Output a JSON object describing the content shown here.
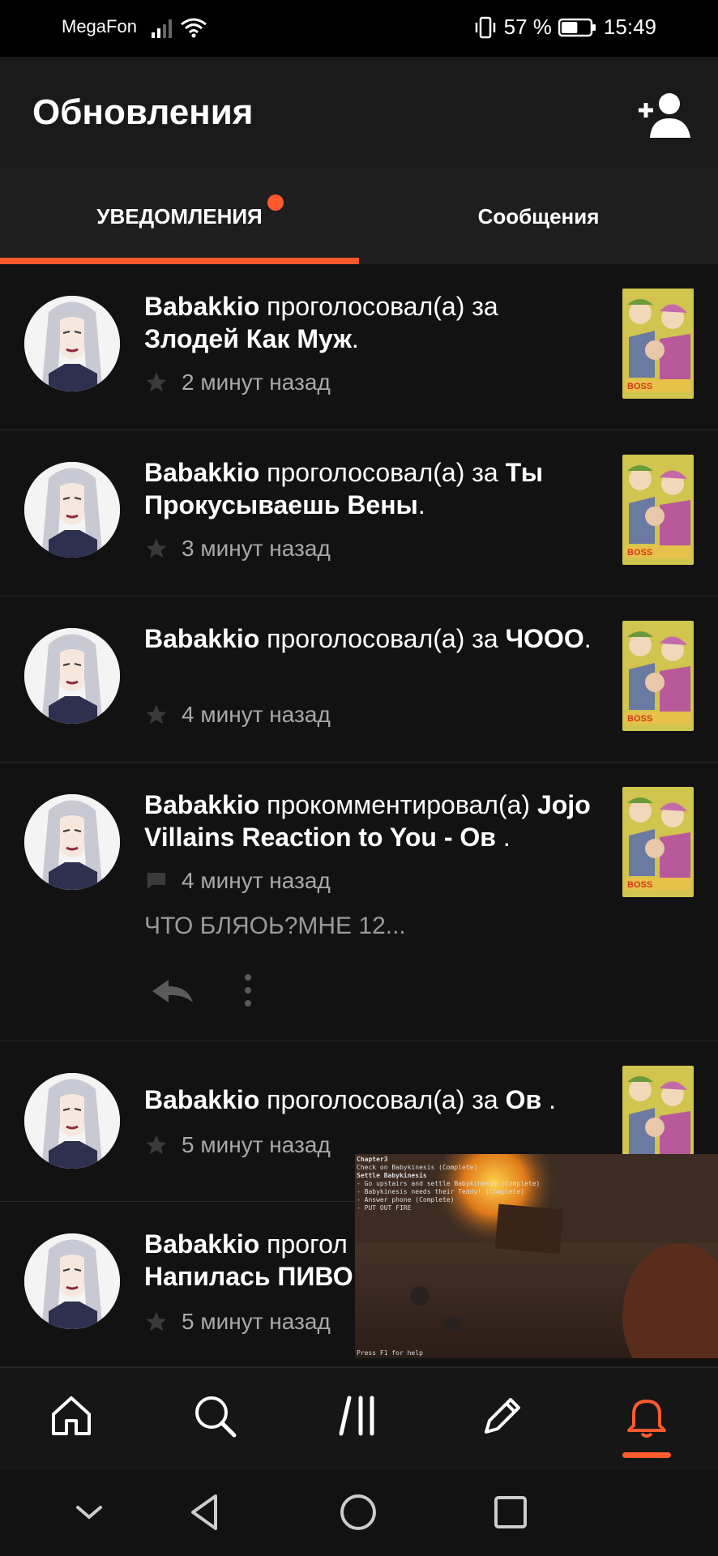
{
  "status_bar": {
    "carrier": "MegaFon",
    "battery_text": "57 %",
    "battery_level": 0.57,
    "time": "15:49"
  },
  "app_bar": {
    "title": "Обновления",
    "action_icon": "add-user-icon"
  },
  "tabs": [
    {
      "label": "УВЕДОМЛЕНИЯ",
      "active": true,
      "has_badge": true
    },
    {
      "label": "Сообщения",
      "active": false,
      "has_badge": false
    }
  ],
  "notifications": [
    {
      "user": "Babakkio",
      "action": "проголосовал(а) за",
      "target": "Злодей Как Муж",
      "suffix": ".",
      "icon": "star-icon",
      "time": "2 минут назад"
    },
    {
      "user": "Babakkio",
      "action": "проголосовал(а) за",
      "target": "Ты Прокусываешь Вены",
      "suffix": ".",
      "icon": "star-icon",
      "time": "3 минут назад"
    },
    {
      "user": "Babakkio",
      "action": "проголосовал(а) за",
      "target": "ЧООО",
      "suffix": ".",
      "icon": "star-icon",
      "time": "4 минут назад"
    },
    {
      "user": "Babakkio",
      "action": "прокомментировал(а)",
      "target": "Jojo Villains Reaction to You - Ов",
      "suffix": " .",
      "icon": "comment-icon",
      "time": "4 минут назад",
      "preview": "ЧТО БЛЯОЬ?МНЕ 12..."
    },
    {
      "user": "Babakkio",
      "action": "проголосовал(а) за",
      "target": "Ов",
      "suffix": " .",
      "icon": "star-icon",
      "time": "5 минут назад"
    },
    {
      "user": "Babakkio",
      "action": "прогол",
      "target": "Напилась ПИВО",
      "suffix": "",
      "icon": "star-icon",
      "time": "5 минут назад"
    }
  ],
  "pip": {
    "lines": [
      "Chapter3",
      "Check on Babykinesis (Complete)",
      "Settle Babykinesis",
      "- Go upstairs and settle Babykinesis (Complete)",
      "- Babykinesis needs their Teddy! (Complete)",
      "- Answer phone (Complete)",
      "- PUT OUT FIRE"
    ],
    "help": "Press F1 for help"
  },
  "bottom_nav": [
    "home-icon",
    "search-icon",
    "library-icon",
    "write-icon",
    "notifications-icon"
  ],
  "colors": {
    "accent": "#ff5a2e",
    "background": "#121212"
  }
}
